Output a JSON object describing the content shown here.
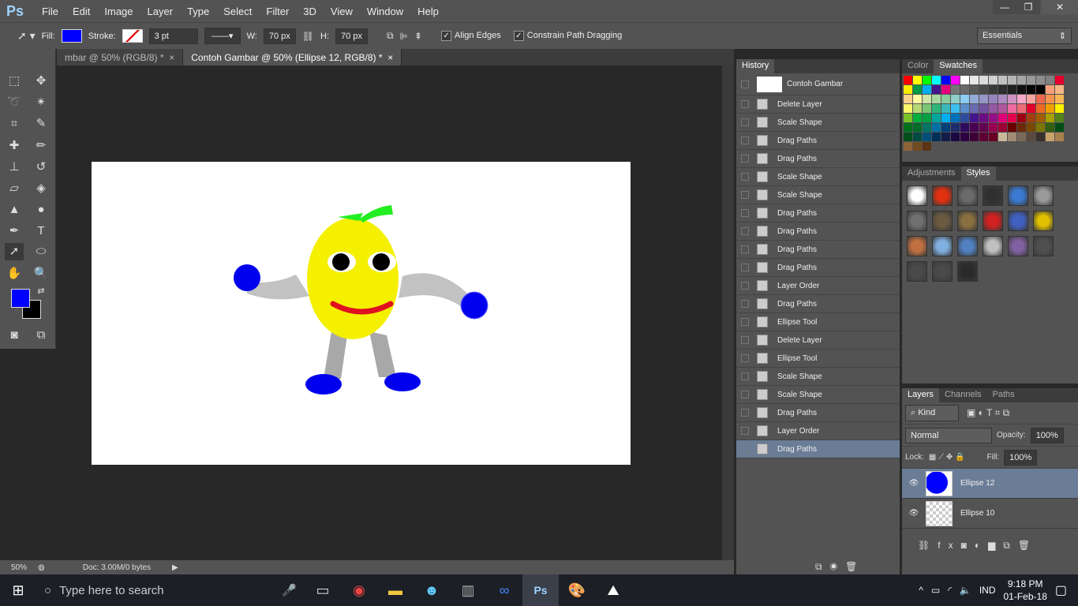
{
  "app": {
    "logo": "Ps"
  },
  "menu": [
    "File",
    "Edit",
    "Image",
    "Layer",
    "Type",
    "Select",
    "Filter",
    "3D",
    "View",
    "Window",
    "Help"
  ],
  "window_controls": {
    "minimize": "—",
    "restore": "❐",
    "close": "✕"
  },
  "options": {
    "fill_label": "Fill:",
    "fill_color": "#0000ff",
    "stroke_label": "Stroke:",
    "stroke_width": "3 pt",
    "w_label": "W:",
    "w_value": "70 px",
    "h_label": "H:",
    "h_value": "70 px",
    "align_edges": "Align Edges",
    "constrain": "Constrain Path Dragging",
    "workspace": "Essentials"
  },
  "tabs": [
    {
      "label": "mbar @ 50% (RGB/8) *"
    },
    {
      "label": "Contoh Gambar @ 50% (Ellipse 12, RGB/8) *"
    }
  ],
  "tab_close": "×",
  "status": {
    "zoom": "50%",
    "doc": "Doc: 3.00M/0 bytes"
  },
  "history": {
    "tab": "History",
    "snapshot": "Contoh Gambar",
    "items": [
      "Delete Layer",
      "Scale Shape",
      "Drag Paths",
      "Drag Paths",
      "Scale Shape",
      "Scale Shape",
      "Drag Paths",
      "Drag Paths",
      "Drag Paths",
      "Drag Paths",
      "Layer Order",
      "Drag Paths",
      "Ellipse Tool",
      "Delete Layer",
      "Ellipse Tool",
      "Scale Shape",
      "Scale Shape",
      "Drag Paths",
      "Layer Order",
      "Drag Paths"
    ]
  },
  "color_panel": {
    "tabs": [
      "Color",
      "Swatches"
    ],
    "swatches": [
      "#ff0000",
      "#ffff00",
      "#00ff00",
      "#00ffff",
      "#0000ff",
      "#ff00ff",
      "#ffffff",
      "#e8e8e8",
      "#dcdcdc",
      "#d0d0d0",
      "#c0c0c0",
      "#b4b4b4",
      "#a4a4a4",
      "#989898",
      "#8c8c8c",
      "#808080",
      "#e4002b",
      "#f7ec00",
      "#009a44",
      "#00aeef",
      "#44148c",
      "#e4007c",
      "#767676",
      "#6a6a6a",
      "#5a5a5a",
      "#4a4a4a",
      "#3a3a3a",
      "#2e2e2e",
      "#202020",
      "#121212",
      "#060606",
      "#000000",
      "#f7a07a",
      "#f6b787",
      "#fdd08e",
      "#fff9a0",
      "#cde5a6",
      "#a8d8a0",
      "#88cc9c",
      "#8ecfcc",
      "#8dcdf4",
      "#93abd8",
      "#9696c8",
      "#9584be",
      "#ac8cc0",
      "#cd92c0",
      "#f5a8c8",
      "#f4a3a0",
      "#ec6b4f",
      "#f5944e",
      "#f6b656",
      "#fff56c",
      "#b5d875",
      "#7ac775",
      "#2fb47a",
      "#3db8b8",
      "#3ebdf0",
      "#5b8ecc",
      "#6a6ab0",
      "#7150a0",
      "#9558a2",
      "#b0569e",
      "#ef6aa0",
      "#ee6c78",
      "#e3002b",
      "#ed6a25",
      "#f19f00",
      "#fff200",
      "#7ac12a",
      "#00ae3c",
      "#00a043",
      "#00a59d",
      "#00aeef",
      "#0070bb",
      "#2e4a9c",
      "#44148c",
      "#6c0d84",
      "#960f88",
      "#e0007a",
      "#e4004c",
      "#9c0012",
      "#a0410f",
      "#a05e00",
      "#a8a000",
      "#55821a",
      "#00701c",
      "#006b2a",
      "#007364",
      "#0070a4",
      "#003f78",
      "#1f2c6c",
      "#2e0b5e",
      "#4a0050",
      "#640050",
      "#960050",
      "#9c0032",
      "#6a0000",
      "#6c2a08",
      "#7a4800",
      "#7c7600",
      "#355f10",
      "#004e16",
      "#004e1c",
      "#004a40",
      "#004e78",
      "#002f58",
      "#111c48",
      "#1c0840",
      "#2c0040",
      "#3e0036",
      "#5e0032",
      "#680024",
      "#cbb89a",
      "#a08c74",
      "#7c6a58",
      "#5a4a40",
      "#3a302c",
      "#c8a46c",
      "#a8804e",
      "#8c6438",
      "#704a20",
      "#5a3414"
    ]
  },
  "styles_panel": {
    "tabs": [
      "Adjustments",
      "Styles"
    ],
    "styles": [
      "#ffffff",
      "#e03010",
      "#6a6a6a",
      "#303030",
      "#3a7ad0",
      "#9a9a9a",
      "#707070",
      "#6a5a40",
      "#8a7040",
      "#d02020",
      "#4060c0",
      "#e0c000",
      "#c07040",
      "#80b0e0",
      "#5080c0",
      "#c0c0c0",
      "#8060a0",
      "#505050",
      "#4a4a4a",
      "#4a4a4a",
      "#2a2a2a"
    ]
  },
  "layers": {
    "tabs": [
      "Layers",
      "Channels",
      "Paths"
    ],
    "kind": "Kind",
    "blend": "Normal",
    "opacity_label": "Opacity:",
    "opacity": "100%",
    "lock_label": "Lock:",
    "fill_label": "Fill:",
    "fill": "100%",
    "items": [
      {
        "name": "Ellipse 12",
        "selected": true
      },
      {
        "name": "Ellipse 10",
        "selected": false
      }
    ]
  },
  "taskbar": {
    "search_placeholder": "Type here to search",
    "lang": "IND",
    "time": "9:18 PM",
    "date": "01-Feb-18"
  },
  "colors": {
    "foreground": "#0000ff",
    "background": "#000000"
  }
}
